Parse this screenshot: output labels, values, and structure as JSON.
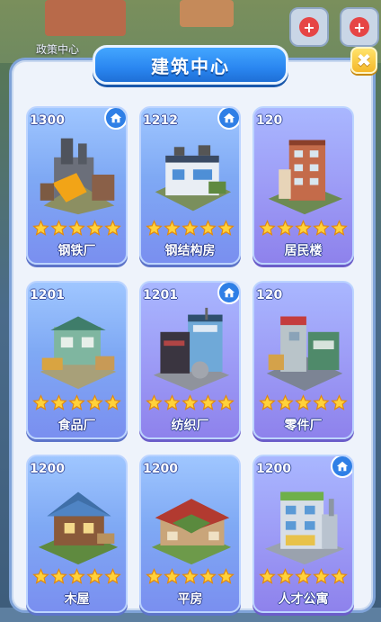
{
  "background": {
    "label": "政策中心"
  },
  "dialog": {
    "title": "建筑中心",
    "close_symbol": "✖"
  },
  "buildings": [
    {
      "level": "1300",
      "name": "钢铁厂",
      "stars": 5,
      "has_home_badge": true,
      "art": "steel-mill-icon"
    },
    {
      "level": "1212",
      "name": "钢结构房",
      "stars": 5,
      "has_home_badge": true,
      "art": "steel-house-icon"
    },
    {
      "level": "120",
      "name": "居民楼",
      "stars": 5,
      "has_home_badge": false,
      "art": "apartment-icon"
    },
    {
      "level": "1201",
      "name": "食品厂",
      "stars": 5,
      "has_home_badge": false,
      "art": "food-factory-icon"
    },
    {
      "level": "1201",
      "name": "纺织厂",
      "stars": 5,
      "has_home_badge": true,
      "art": "textile-mill-icon"
    },
    {
      "level": "120",
      "name": "零件厂",
      "stars": 5,
      "has_home_badge": false,
      "art": "parts-factory-icon"
    },
    {
      "level": "1200",
      "name": "木屋",
      "stars": 5,
      "has_home_badge": false,
      "art": "wood-cabin-icon"
    },
    {
      "level": "1200",
      "name": "平房",
      "stars": 5,
      "has_home_badge": false,
      "art": "bungalow-icon"
    },
    {
      "level": "1200",
      "name": "人才公寓",
      "stars": 5,
      "has_home_badge": true,
      "art": "talent-apartment-icon"
    }
  ],
  "colors": {
    "accent_blue": "#2a86f0",
    "star_yellow": "#ffd23a",
    "close_yellow": "#f5b82a"
  }
}
